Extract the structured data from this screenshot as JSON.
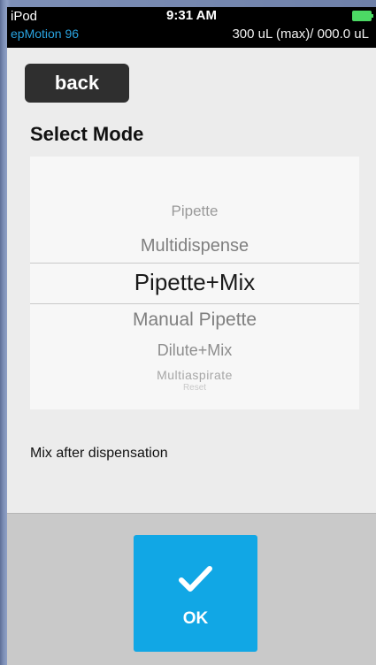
{
  "status_bar": {
    "carrier": "iPod",
    "time": "9:31 AM",
    "app_name": "epMotion 96",
    "volume_info": "300 uL (max)/ 000.0 uL",
    "battery_color": "#4cd964"
  },
  "back_button": {
    "label": "back"
  },
  "page": {
    "title": "Select Mode"
  },
  "picker": {
    "items": [
      "Pipette",
      "Multidispense",
      "Pipette+Mix",
      "Manual Pipette",
      "Dilute+Mix",
      "Multiaspirate",
      "Reset"
    ],
    "selected": "Pipette+Mix"
  },
  "mode_description": "Mix after dispensation",
  "ok_button": {
    "label": "OK",
    "icon": "checkmark-icon",
    "color": "#11a7e5"
  }
}
